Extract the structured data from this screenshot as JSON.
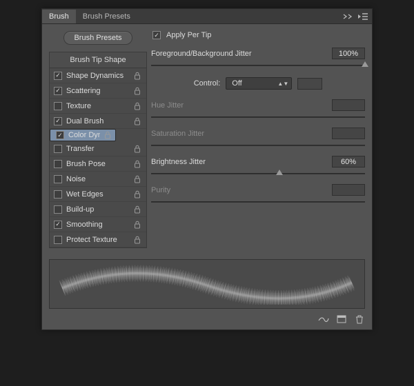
{
  "tabs": {
    "brush": "Brush",
    "presets": "Brush Presets"
  },
  "buttons": {
    "presets": "Brush Presets"
  },
  "list": {
    "header": "Brush Tip Shape",
    "items": [
      {
        "label": "Shape Dynamics",
        "checked": true
      },
      {
        "label": "Scattering",
        "checked": true
      },
      {
        "label": "Texture",
        "checked": false
      },
      {
        "label": "Dual Brush",
        "checked": true
      },
      {
        "label": "Color Dynamics",
        "checked": true,
        "selected": true
      },
      {
        "label": "Transfer",
        "checked": false
      },
      {
        "label": "Brush Pose",
        "checked": false
      },
      {
        "label": "Noise",
        "checked": false
      },
      {
        "label": "Wet Edges",
        "checked": false
      },
      {
        "label": "Build-up",
        "checked": false
      },
      {
        "label": "Smoothing",
        "checked": true
      },
      {
        "label": "Protect Texture",
        "checked": false
      }
    ]
  },
  "settings": {
    "apply_per_tip": {
      "label": "Apply Per Tip",
      "checked": true
    },
    "fg_bg_jitter": {
      "label": "Foreground/Background Jitter",
      "value": "100%",
      "pos": 100
    },
    "control": {
      "label": "Control:",
      "value": "Off"
    },
    "hue": {
      "label": "Hue Jitter",
      "value": "",
      "pos": 0
    },
    "sat": {
      "label": "Saturation Jitter",
      "value": "",
      "pos": 0
    },
    "bri": {
      "label": "Brightness Jitter",
      "value": "60%",
      "pos": 60
    },
    "purity": {
      "label": "Purity",
      "value": "",
      "pos": 50
    }
  }
}
